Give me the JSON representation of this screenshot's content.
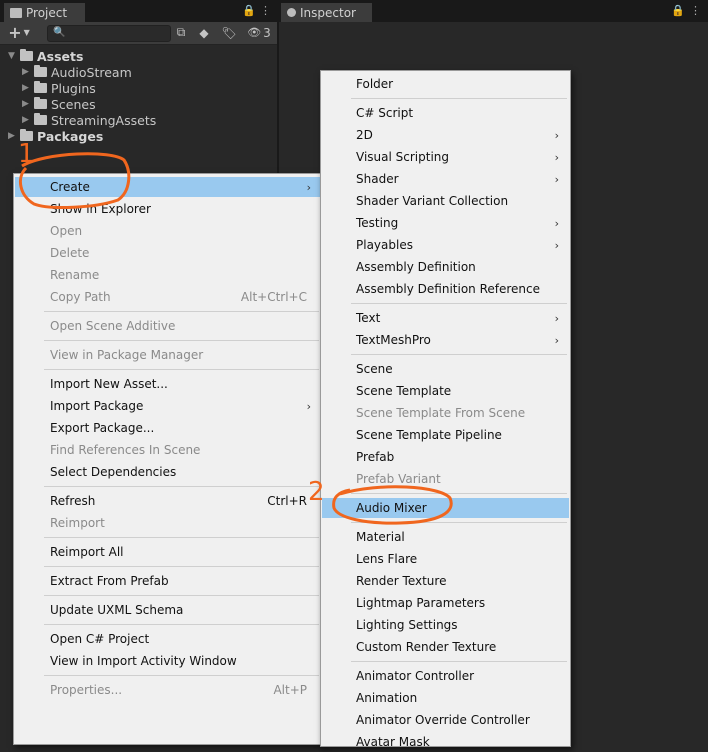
{
  "project_panel": {
    "tab_label": "Project",
    "hidden_count": "3",
    "search_placeholder": "",
    "tree": [
      {
        "label": "Assets",
        "bold": true,
        "expanded": true
      },
      {
        "label": "AudioStream"
      },
      {
        "label": "Plugins"
      },
      {
        "label": "Scenes"
      },
      {
        "label": "StreamingAssets"
      },
      {
        "label": "Packages",
        "bold": true,
        "expanded": false
      }
    ]
  },
  "inspector_panel": {
    "tab_label": "Inspector"
  },
  "context_menu": {
    "items": [
      {
        "label": "Create",
        "submenu": true,
        "highlighted": true
      },
      {
        "label": "Show in Explorer"
      },
      {
        "label": "Open",
        "disabled": true
      },
      {
        "label": "Delete",
        "disabled": true
      },
      {
        "label": "Rename",
        "disabled": true
      },
      {
        "label": "Copy Path",
        "shortcut": "Alt+Ctrl+C",
        "disabled": true
      },
      {
        "label": "Open Scene Additive",
        "disabled": true
      },
      {
        "label": "View in Package Manager",
        "disabled": true
      },
      {
        "label": "Import New Asset..."
      },
      {
        "label": "Import Package",
        "submenu": true
      },
      {
        "label": "Export Package..."
      },
      {
        "label": "Find References In Scene",
        "disabled": true
      },
      {
        "label": "Select Dependencies"
      },
      {
        "label": "Refresh",
        "shortcut": "Ctrl+R"
      },
      {
        "label": "Reimport",
        "disabled": true
      },
      {
        "label": "Reimport All"
      },
      {
        "label": "Extract From Prefab"
      },
      {
        "label": "Update UXML Schema"
      },
      {
        "label": "Open C# Project"
      },
      {
        "label": "View in Import Activity Window"
      },
      {
        "label": "Properties...",
        "shortcut": "Alt+P",
        "disabled": true
      }
    ]
  },
  "create_submenu": {
    "items": [
      {
        "label": "Folder"
      },
      {
        "label": "C# Script"
      },
      {
        "label": "2D",
        "submenu": true
      },
      {
        "label": "Visual Scripting",
        "submenu": true
      },
      {
        "label": "Shader",
        "submenu": true
      },
      {
        "label": "Shader Variant Collection"
      },
      {
        "label": "Testing",
        "submenu": true
      },
      {
        "label": "Playables",
        "submenu": true
      },
      {
        "label": "Assembly Definition"
      },
      {
        "label": "Assembly Definition Reference"
      },
      {
        "label": "Text",
        "submenu": true
      },
      {
        "label": "TextMeshPro",
        "submenu": true
      },
      {
        "label": "Scene"
      },
      {
        "label": "Scene Template"
      },
      {
        "label": "Scene Template From Scene",
        "disabled": true
      },
      {
        "label": "Scene Template Pipeline"
      },
      {
        "label": "Prefab"
      },
      {
        "label": "Prefab Variant",
        "disabled": true
      },
      {
        "label": "Audio Mixer",
        "highlighted": true
      },
      {
        "label": "Material"
      },
      {
        "label": "Lens Flare"
      },
      {
        "label": "Render Texture"
      },
      {
        "label": "Lightmap Parameters"
      },
      {
        "label": "Lighting Settings"
      },
      {
        "label": "Custom Render Texture"
      },
      {
        "label": "Animator Controller"
      },
      {
        "label": "Animation"
      },
      {
        "label": "Animator Override Controller"
      },
      {
        "label": "Avatar Mask"
      }
    ]
  },
  "annotations": {
    "step1": "1",
    "step2": "2",
    "color": "#f0661e"
  },
  "colors": {
    "highlight": "#99c9ef",
    "menu_bg": "#f0f0f0",
    "editor_bg": "#282828"
  }
}
